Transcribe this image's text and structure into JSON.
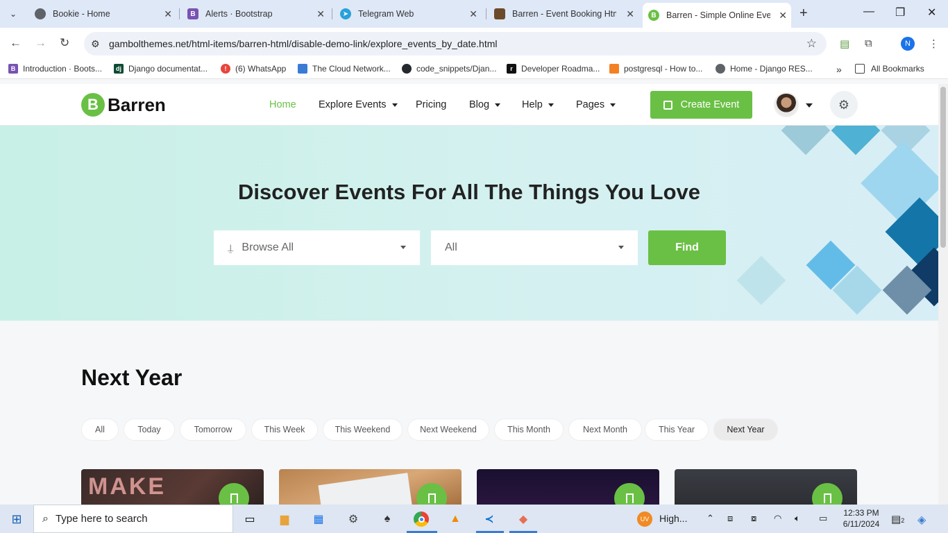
{
  "browser": {
    "tabs": [
      {
        "label": "Bookie - Home",
        "icon_color": "#5f6368",
        "icon": "globe-icon"
      },
      {
        "label": "Alerts · Bootstrap",
        "icon_color": "#7952b3",
        "icon": "bootstrap-icon",
        "icon_text": "B"
      },
      {
        "label": "Telegram Web",
        "icon_color": "#2aa1da",
        "icon": "telegram-icon"
      },
      {
        "label": "Barren - Event Booking Html",
        "icon_color": "#6b4a2b",
        "icon": "barren-thumb-icon"
      },
      {
        "label": "Barren - Simple Online Event",
        "icon_color": "#6ac045",
        "icon": "barren-logo-icon",
        "icon_text": "B"
      }
    ],
    "url": "gambolthemes.net/html-items/barren-html/disable-demo-link/explore_events_by_date.html",
    "profile_initial": "N",
    "bookmarks": [
      {
        "label": "Introduction · Boots...",
        "icon_color": "#7952b3",
        "icon_text": "B"
      },
      {
        "label": "Django documentat...",
        "icon_color": "#0c4b33",
        "icon_text": "dj"
      },
      {
        "label": "(6) WhatsApp",
        "icon_color": "#e8453c",
        "icon_text": "!"
      },
      {
        "label": "The Cloud Network...",
        "icon_color": "#3a7bd5",
        "icon_text": ""
      },
      {
        "label": "code_snippets/Djan...",
        "icon_color": "#24292f",
        "icon_text": ""
      },
      {
        "label": "Developer Roadma...",
        "icon_color": "#111111",
        "icon_text": "r"
      },
      {
        "label": "postgresql - How to...",
        "icon_color": "#f48024",
        "icon_text": ""
      },
      {
        "label": "Home - Django RES...",
        "icon_color": "#5f6368",
        "icon_text": ""
      }
    ],
    "all_bookmarks": "All Bookmarks"
  },
  "site": {
    "logo_letter": "B",
    "logo_name": "Barren",
    "nav": [
      {
        "label": "Home",
        "active": true,
        "caret": false
      },
      {
        "label": "Explore Events",
        "active": false,
        "caret": true
      },
      {
        "label": "Pricing",
        "active": false,
        "caret": false
      },
      {
        "label": "Blog",
        "active": false,
        "caret": true
      },
      {
        "label": "Help",
        "active": false,
        "caret": true
      },
      {
        "label": "Pages",
        "active": false,
        "caret": true
      }
    ],
    "create_event": "Create Event",
    "accent": "#6ac045"
  },
  "hero": {
    "title": "Discover Events For All The Things You Love",
    "select_type": "Browse All",
    "select_category": "All",
    "find": "Find"
  },
  "section": {
    "title": "Next Year",
    "filters": [
      {
        "label": "All",
        "active": false
      },
      {
        "label": "Today",
        "active": false
      },
      {
        "label": "Tomorrow",
        "active": false
      },
      {
        "label": "This Week",
        "active": false
      },
      {
        "label": "This Weekend",
        "active": false
      },
      {
        "label": "Next Weekend",
        "active": false
      },
      {
        "label": "This Month",
        "active": false
      },
      {
        "label": "Next Month",
        "active": false
      },
      {
        "label": "This Year",
        "active": false
      },
      {
        "label": "Next Year",
        "active": true
      }
    ],
    "cards": [
      {
        "image": "make-today-chalkboard"
      },
      {
        "image": "art-supplies-wood-table"
      },
      {
        "image": "dark-purple-stage"
      },
      {
        "image": "dark-still-life"
      }
    ]
  },
  "taskbar": {
    "search_placeholder": "Type here to search",
    "weather": "High...",
    "weather_badge": "UV",
    "time": "12:33 PM",
    "date": "6/11/2024",
    "notifications": "2"
  }
}
